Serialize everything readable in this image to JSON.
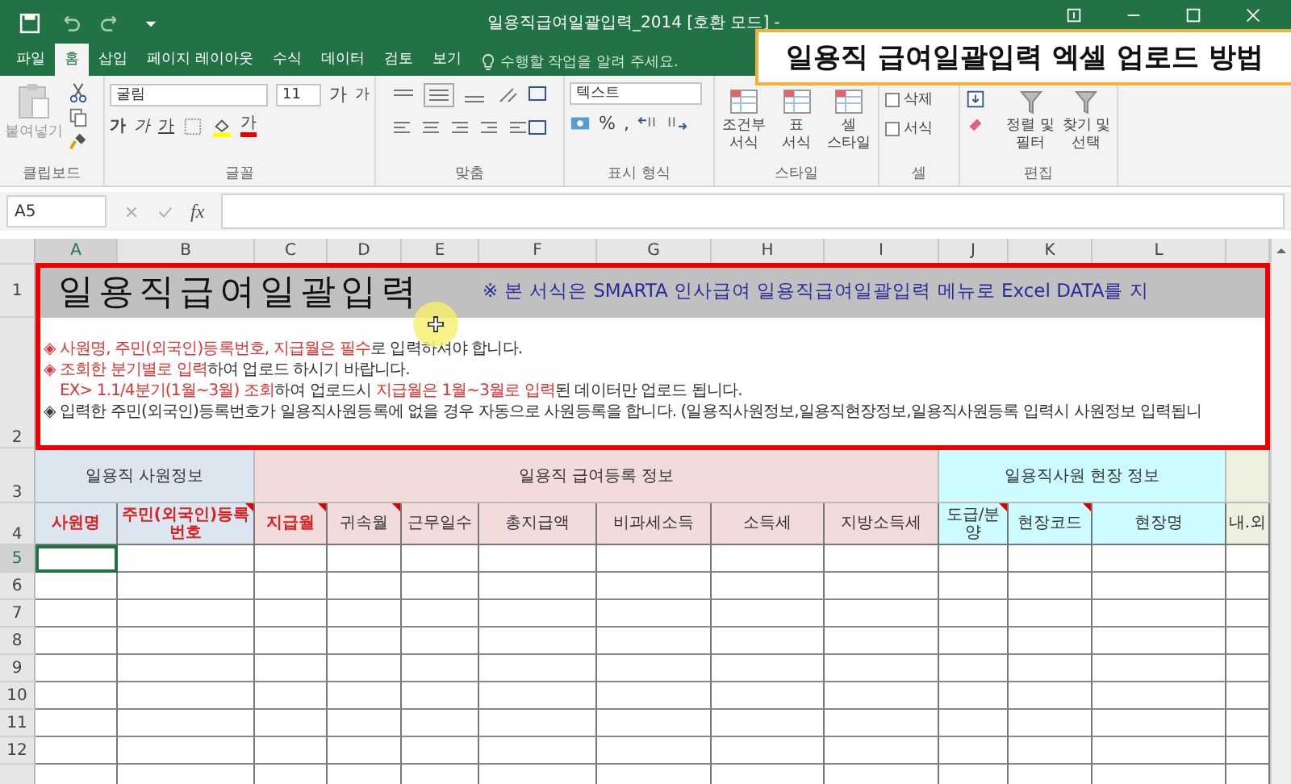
{
  "window": {
    "title": "일용직급여일괄입력_2014 [호환 모드] -"
  },
  "ribbon_tabs": [
    {
      "label": "파일",
      "selected": false
    },
    {
      "label": "홈",
      "selected": true
    },
    {
      "label": "삽입",
      "selected": false
    },
    {
      "label": "페이지 레이아웃",
      "selected": false
    },
    {
      "label": "수식",
      "selected": false
    },
    {
      "label": "데이터",
      "selected": false
    },
    {
      "label": "검토",
      "selected": false
    },
    {
      "label": "보기",
      "selected": false
    }
  ],
  "tell_me": {
    "placeholder": "수행할 작업을 알려 주세요."
  },
  "clipboard": {
    "label": "클립보드",
    "paste": "붙여넣기"
  },
  "font": {
    "label": "글꼴",
    "family": "굴림",
    "size": "11",
    "grow": "가",
    "shrink": "가",
    "bold": "가",
    "italic": "가",
    "underline": "가",
    "font_color": "가"
  },
  "alignment": {
    "label": "맞춤"
  },
  "number": {
    "label": "표시 형식",
    "format": "텍스트",
    "percent": "%",
    "comma": ","
  },
  "styles": {
    "label": "스타일",
    "buttons": [
      "조건부\n서식",
      "표\n서식",
      "셀\n스타일"
    ]
  },
  "cells": {
    "label": "셀",
    "buttons": [
      "삭제",
      "서식"
    ]
  },
  "editing": {
    "label": "편집",
    "buttons": [
      "정렬 및 필터",
      "찾기 및 선택"
    ]
  },
  "formula_bar": {
    "name_box": "A5",
    "fx": "fx"
  },
  "column_headers": [
    {
      "label": "A",
      "selected": true
    },
    {
      "label": "B",
      "selected": false
    },
    {
      "label": "C",
      "selected": false
    },
    {
      "label": "D",
      "selected": false
    },
    {
      "label": "E",
      "selected": false
    },
    {
      "label": "F",
      "selected": false
    },
    {
      "label": "G",
      "selected": false
    },
    {
      "label": "H",
      "selected": false
    },
    {
      "label": "I",
      "selected": false
    },
    {
      "label": "J",
      "selected": false
    },
    {
      "label": "K",
      "selected": false
    },
    {
      "label": "L",
      "selected": false
    }
  ],
  "sheet": {
    "title": "일용직급여일괄입력",
    "notice": "※ 본 서식은 SMARTA 인사급여 일용직급여일괄입력 메뉴로 Excel DATA를 지",
    "notes": [
      {
        "indent": false,
        "segments": [
          {
            "text": "◈ 사원명, 주민(외국인)등록번호, 지급월은 필수",
            "red": true
          },
          {
            "text": "로 입력하셔야 합니다.",
            "red": false
          }
        ]
      },
      {
        "indent": false,
        "segments": [
          {
            "text": "◈ 조회한 분기별로 입력",
            "red": true
          },
          {
            "text": "하여 업로드 하시기 바랍니다.",
            "red": false
          }
        ]
      },
      {
        "indent": true,
        "segments": [
          {
            "text": "EX> 1.1/4분기(1월~3월) 조회",
            "red": true
          },
          {
            "text": "하여 업로드시 ",
            "red": false
          },
          {
            "text": "지급월은 1월~3월로 입력",
            "red": true
          },
          {
            "text": "된 데이터만 업로드 됩니다.",
            "red": false
          }
        ]
      },
      {
        "indent": false,
        "segments": [
          {
            "text": "◈ 입력한 주민(외국인)등록번호가 일용직사원등록에 없을 경우 자동으로 사원등록을 합니다. (일용직사원정보,일용직현장정보,일용직사원등록 입력시 사원정보 입력됩니",
            "red": false
          }
        ]
      }
    ],
    "groups": [
      {
        "label": "일용직 사원정보",
        "color": "#dce6f1",
        "headers": [
          {
            "label": "사원명",
            "required": true,
            "comment": false
          },
          {
            "label": "주민(외국인)등록번호",
            "required": true,
            "comment": true
          }
        ]
      },
      {
        "label": "일용직 급여등록 정보",
        "color": "#f2dcdb",
        "headers": [
          {
            "label": "지급월",
            "required": true,
            "comment": true
          },
          {
            "label": "귀속월",
            "required": false,
            "comment": true
          },
          {
            "label": "근무일수",
            "required": false,
            "comment": false
          },
          {
            "label": "총지급액",
            "required": false,
            "comment": false
          },
          {
            "label": "비과세소득",
            "required": false,
            "comment": false
          },
          {
            "label": "소득세",
            "required": false,
            "comment": false
          },
          {
            "label": "지방소득세",
            "required": false,
            "comment": false
          }
        ]
      },
      {
        "label": "일용직사원 현장 정보",
        "color": "#ccfcff",
        "headers": [
          {
            "label": "도급/분양",
            "required": false,
            "comment": true
          },
          {
            "label": "현장코드",
            "required": false,
            "comment": true
          },
          {
            "label": "현장명",
            "required": false,
            "comment": false
          }
        ]
      },
      {
        "color": "#ebf1de",
        "headers": [
          {
            "label": "내.외",
            "required": false,
            "comment": false
          }
        ]
      }
    ],
    "header_row_numbers": [
      "1",
      "2",
      "3",
      "4"
    ],
    "data_rows": [
      {
        "number": "5",
        "selected": true
      },
      {
        "number": "6",
        "selected": false
      },
      {
        "number": "7",
        "selected": false
      },
      {
        "number": "8",
        "selected": false
      },
      {
        "number": "9",
        "selected": false
      },
      {
        "number": "10",
        "selected": false
      },
      {
        "number": "11",
        "selected": false
      },
      {
        "number": "12",
        "selected": false
      }
    ]
  },
  "caption": "일용직 급여일괄입력 엑셀 업로드 방법"
}
